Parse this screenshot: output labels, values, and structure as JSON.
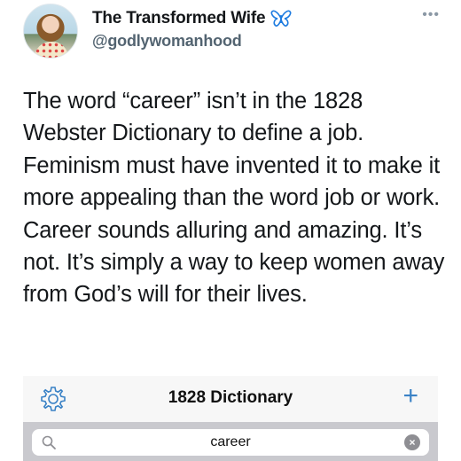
{
  "tweet": {
    "display_name": "The Transformed Wife",
    "handle": "@godlywomanhood",
    "verified_icon": "butterfly-icon",
    "more_icon": "more-dots-icon",
    "text": "The word “career” isn’t in the 1828 Webster Dictionary to define a job. Feminism must have invented it to make it more appealing than the word job or work. Career sounds alluring and amazing. It’s not. It’s simply a way to keep women away from God’s will for their lives."
  },
  "dictionary_app": {
    "title": "1828 Dictionary",
    "settings_icon": "gear-icon",
    "add_icon": "plus-icon",
    "add_label": "+",
    "search": {
      "value": "career",
      "search_icon": "search-icon",
      "clear_icon": "clear-icon"
    }
  },
  "colors": {
    "accent": "#3a82c6",
    "text": "#14171a",
    "secondary": "#536471"
  }
}
